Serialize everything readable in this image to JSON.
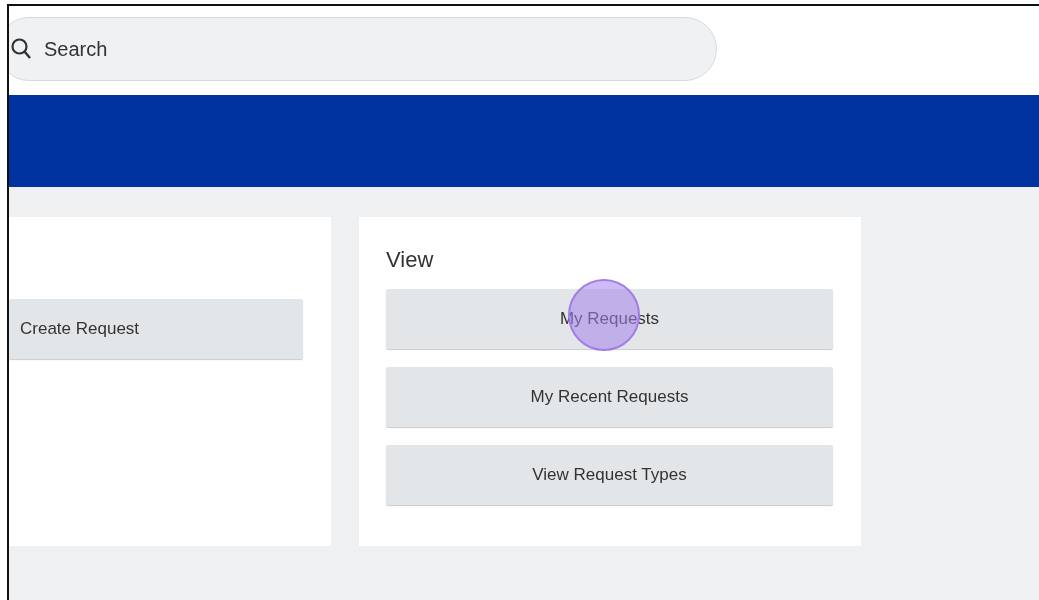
{
  "search": {
    "placeholder": "Search"
  },
  "cards": [
    {
      "buttons": [
        {
          "label": "Create Request",
          "highlighted": false
        }
      ]
    },
    {
      "title": "View",
      "buttons": [
        {
          "label": "My Requests",
          "highlighted": true
        },
        {
          "label": "My Recent Requests",
          "highlighted": false
        },
        {
          "label": "View Request Types",
          "highlighted": false
        }
      ]
    }
  ]
}
